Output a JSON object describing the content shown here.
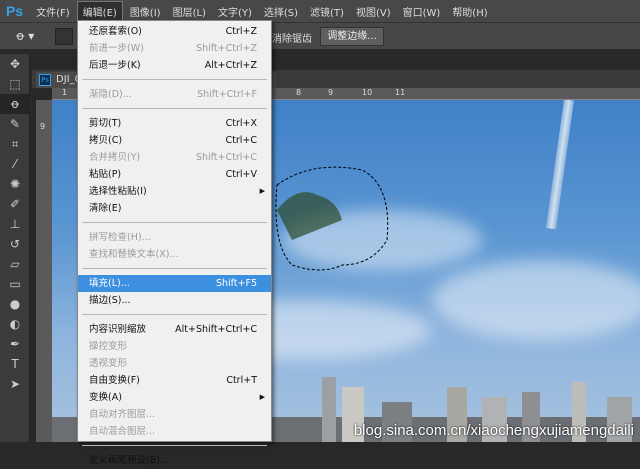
{
  "menubar": {
    "logo": "Ps",
    "items": [
      "文件(F)",
      "编辑(E)",
      "图像(I)",
      "图层(L)",
      "文字(Y)",
      "选择(S)",
      "滤镜(T)",
      "视图(V)",
      "窗口(W)",
      "帮助(H)"
    ]
  },
  "options": {
    "antialias": "消除锯齿",
    "refine_edge": "调整边缘..."
  },
  "document": {
    "tab": "DJI_0"
  },
  "ruler": {
    "h": [
      "1",
      "8",
      "9",
      "10",
      "11"
    ],
    "v": [
      "9"
    ]
  },
  "edit_menu": {
    "undo": {
      "label": "还原套索(O)",
      "shortcut": "Ctrl+Z"
    },
    "step_forward": {
      "label": "前进一步(W)",
      "shortcut": "Shift+Ctrl+Z"
    },
    "step_backward": {
      "label": "后退一步(K)",
      "shortcut": "Alt+Ctrl+Z"
    },
    "fade": {
      "label": "渐隐(D)...",
      "shortcut": "Shift+Ctrl+F"
    },
    "cut": {
      "label": "剪切(T)",
      "shortcut": "Ctrl+X"
    },
    "copy": {
      "label": "拷贝(C)",
      "shortcut": "Ctrl+C"
    },
    "copy_merged": {
      "label": "合并拷贝(Y)",
      "shortcut": "Shift+Ctrl+C"
    },
    "paste": {
      "label": "粘贴(P)",
      "shortcut": "Ctrl+V"
    },
    "paste_special": {
      "label": "选择性粘贴(I)"
    },
    "clear": {
      "label": "清除(E)"
    },
    "spell_check": {
      "label": "拼写检查(H)..."
    },
    "find_replace": {
      "label": "查找和替换文本(X)..."
    },
    "fill": {
      "label": "填充(L)...",
      "shortcut": "Shift+F5"
    },
    "stroke": {
      "label": "描边(S)..."
    },
    "content_aware_scale": {
      "label": "内容识别缩放",
      "shortcut": "Alt+Shift+Ctrl+C"
    },
    "puppet_warp": {
      "label": "操控变形"
    },
    "perspective_warp": {
      "label": "透视变形"
    },
    "free_transform": {
      "label": "自由变换(F)",
      "shortcut": "Ctrl+T"
    },
    "transform": {
      "label": "变换(A)"
    },
    "auto_align": {
      "label": "自动对齐图层..."
    },
    "auto_blend": {
      "label": "自动混合图层..."
    },
    "define_brush": {
      "label": "定义画笔预设(B)..."
    }
  },
  "watermark": "blog.sina.com.cn/xiaochengxujiamengdaili"
}
